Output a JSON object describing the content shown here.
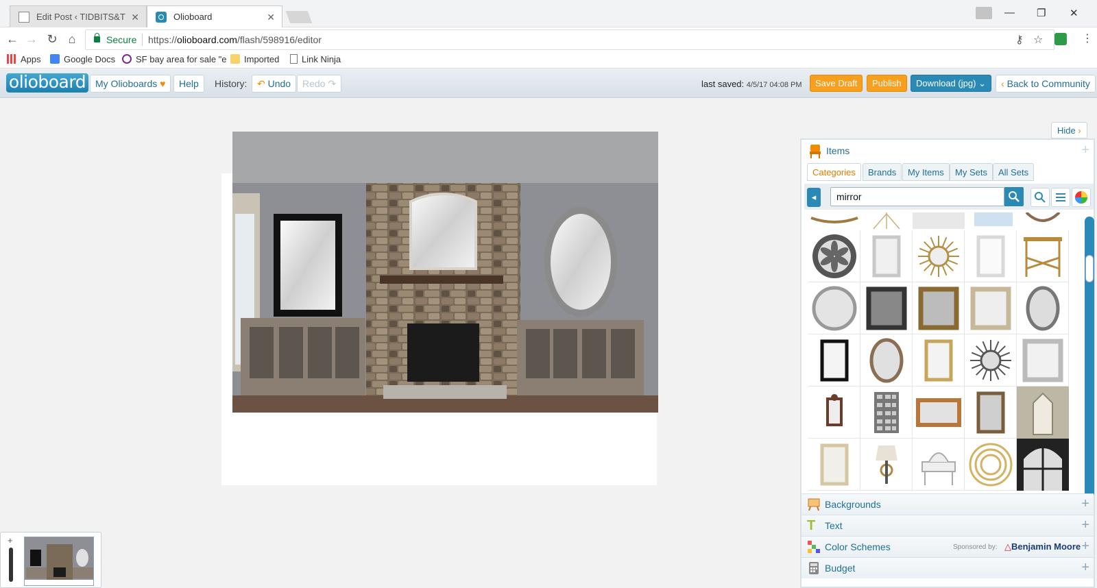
{
  "browser": {
    "tabs": [
      {
        "title": "Edit Post ‹ TIDBITS&TWIN"
      },
      {
        "title": "Olioboard"
      }
    ],
    "address": {
      "secure_label": "Secure",
      "url_scheme": "https://",
      "url_host": "olioboard.com",
      "url_path": "/flash/598916/editor"
    },
    "bookmarks": [
      "Apps",
      "Google Docs",
      "SF bay area for sale \"e",
      "Imported",
      "Link Ninja"
    ]
  },
  "app": {
    "logo": "olioboard",
    "my_olioboards": "My Olioboards",
    "help": "Help",
    "history_label": "History:",
    "undo": "Undo",
    "redo": "Redo",
    "last_saved_label": "last saved:",
    "last_saved_value": "4/5/17 04:08 PM",
    "save_draft": "Save Draft",
    "publish": "Publish",
    "download": "Download (jpg)",
    "back": "Back to Community"
  },
  "panel": {
    "hide": "Hide",
    "title": "Items",
    "tabs": [
      "Categories",
      "Brands",
      "My Items",
      "My Sets",
      "All Sets"
    ],
    "active_tab": "Categories",
    "search_value": "mirror",
    "sections": [
      "Backgrounds",
      "Text",
      "Color Schemes",
      "Budget"
    ],
    "sponsored_by": "Sponsored by:",
    "sponsor_name": "Benjamin Moore",
    "items": [
      "round-medallion-mirror",
      "silver-rect-mirror",
      "sunburst-twig-mirror",
      "frameless-rect-mirror",
      "bamboo-console",
      "round-frameless-mirror",
      "black-panel-mirror",
      "gold-square-mirror",
      "champagne-rect-mirror",
      "oval-silver-mirror",
      "black-rect-mirror",
      "bronze-oval-mirror",
      "gold-double-mirror",
      "starburst-mirror",
      "silver-frame-mirror",
      "wood-small-mirror",
      "glass-block-mirror",
      "gold-landscape-mirror",
      "tall-bronze-mirror",
      "pagoda-mirror",
      "pale-gold-mirror",
      "table-lamp",
      "mirrored-vanity",
      "gold-ring-mirror",
      "arched-window-mirror"
    ]
  },
  "colors": {
    "accent": "#2b8ab5",
    "orange": "#f6a01e",
    "link": "#1f6f96"
  }
}
